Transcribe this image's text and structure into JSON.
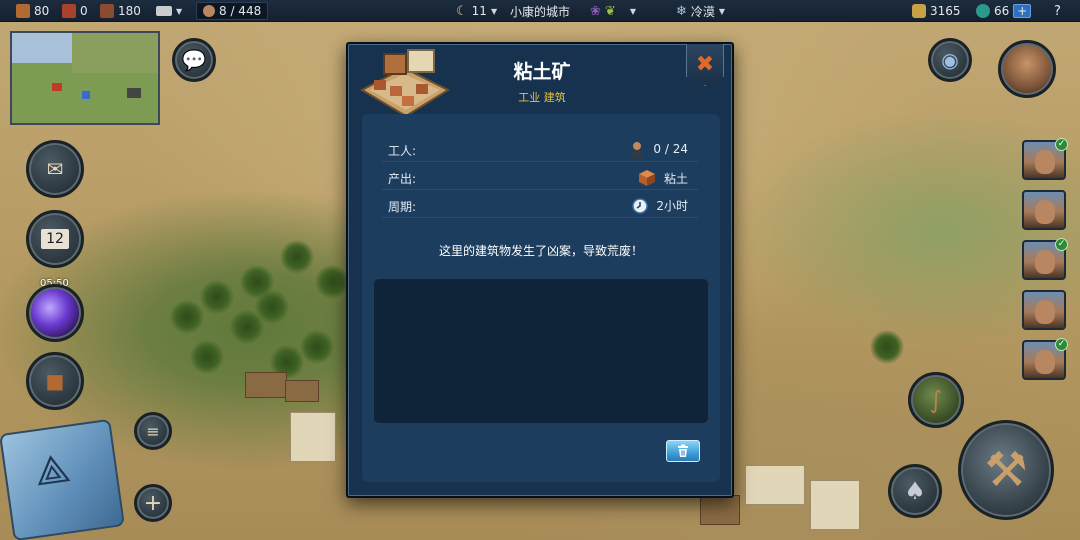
{
  "topbar": {
    "wood": "80",
    "brick": "0",
    "stone": "180",
    "population": "8 / 448",
    "level": "11",
    "city_name": "小康的城市",
    "climate": "冷漠",
    "coins": "3165",
    "gems": "66",
    "plus": "+",
    "help": "?"
  },
  "sidebar": {
    "calendar_day": "12",
    "timer": "05:50"
  },
  "dialog": {
    "title": "粘土矿",
    "subtitle": "工业 建筑",
    "close_glyph": "✖",
    "rows": [
      {
        "label": "工人:",
        "value": "0 / 24",
        "icon": "worker-icon"
      },
      {
        "label": "产出:",
        "value": "粘土",
        "icon": "clay-cube-icon"
      },
      {
        "label": "周期:",
        "value": "2小时",
        "icon": "clock-icon"
      }
    ],
    "message": "这里的建筑物发生了凶案，导致荒废！",
    "text_area": ""
  },
  "colors": {
    "dialog_bg": "#16324e",
    "panel_bg": "#1c3d5e",
    "subtitle": "#e8c23a",
    "close_x": "#e0682a",
    "trash_button": "#3c9fd8"
  }
}
